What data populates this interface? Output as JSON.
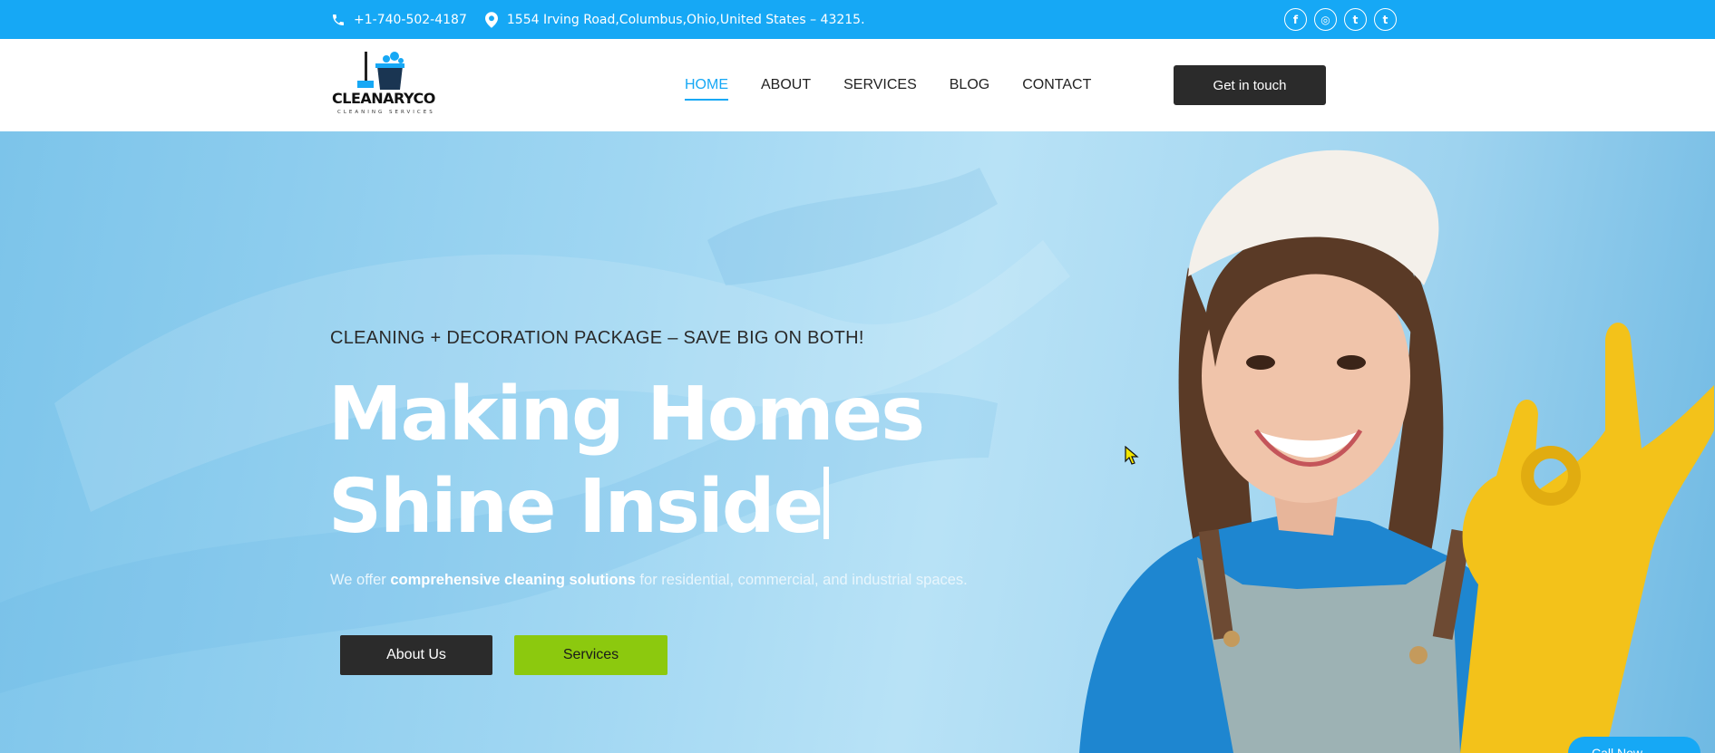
{
  "topbar": {
    "phone": "+1-740-502-4187",
    "address": "1554 Irving Road,Columbus,Ohio,United States – 43215.",
    "social": [
      "facebook-icon",
      "instagram-icon",
      "twitter-icon",
      "tumblr-icon"
    ],
    "social_glyphs": [
      "f",
      "◎",
      "t",
      "t"
    ],
    "color": "#16a8f5"
  },
  "header": {
    "logo_name": "CLEANARYCO",
    "logo_tagline": "CLEANING SERVICES",
    "nav": [
      {
        "label": "HOME",
        "active": true
      },
      {
        "label": "ABOUT",
        "active": false
      },
      {
        "label": "SERVICES",
        "active": false
      },
      {
        "label": "BLOG",
        "active": false
      },
      {
        "label": "CONTACT",
        "active": false
      }
    ],
    "cta_label": "Get in touch"
  },
  "hero": {
    "eyebrow": "CLEANING + DECORATION PACKAGE – SAVE BIG ON BOTH!",
    "headline_line1": "Making Homes",
    "headline_line2": "Shine Inside",
    "sub_prefix": "We offer ",
    "sub_bold": "comprehensive cleaning solutions",
    "sub_suffix": " for residential, commercial, and industrial spaces.",
    "btn_about": "About Us",
    "btn_services": "Services",
    "call_now": "Call Now"
  },
  "colors": {
    "accent": "#16a8f5",
    "dark_button": "#2b2b2b",
    "green_button": "#8cc90e"
  }
}
